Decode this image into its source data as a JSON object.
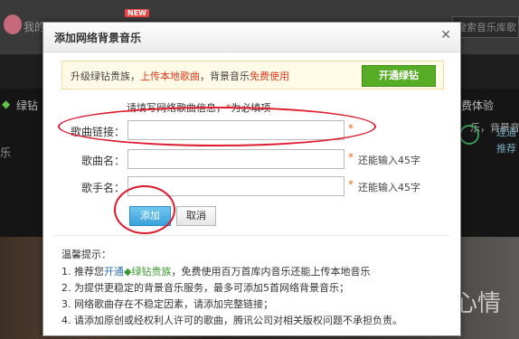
{
  "background": {
    "me_label": "我的",
    "new_badge": "NEW",
    "search_placeholder": "搜索音乐库歌",
    "right_text": "乐，背景音乐",
    "left_text": "绿钻",
    "left_text2": "乐",
    "right_text2": "费体验",
    "right_text3a": "连通",
    "right_text3b": "推荐",
    "photo_text": "心情"
  },
  "dialog": {
    "title": "添加网络背景音乐",
    "close_icon": "close-icon",
    "promo": {
      "part1": "升级绿钻贵族，",
      "part2": "上传本地歌曲",
      "part3": "，背景音乐",
      "part4": "免费使用",
      "button": "开通绿钻"
    },
    "hint": {
      "text": "请填写网络歌曲信息，",
      "star": "*",
      "suffix": "为必填项"
    },
    "fields": [
      {
        "label": "歌曲链接：",
        "value": "",
        "placeholder": "",
        "required": "*",
        "remain": ""
      },
      {
        "label": "歌曲名：",
        "value": "",
        "placeholder": "",
        "required": "*",
        "remain": "还能输入45字"
      },
      {
        "label": "歌手名：",
        "value": "",
        "placeholder": "",
        "required": "*",
        "remain": "还能输入45字"
      }
    ],
    "buttons": {
      "add": "添加",
      "cancel": "取消"
    },
    "tips": {
      "title": "温馨提示：",
      "line1_a": "1. 推荐您",
      "line1_link": "开通",
      "line1_gem": "◆绿钻贵族",
      "line1_b": "，免费使用百万首库内音乐还能上传本地音乐",
      "line2": "2. 为提供更稳定的背景音乐服务，最多可添加5首网络背景音乐；",
      "line3": "3. 网络歌曲存在不稳定因素，请添加完整链接；",
      "line4": "4. 请添加原创或经权利人许可的歌曲，腾讯公司对相关版权问题不承担负责。"
    }
  },
  "colors": {
    "accent_red": "#e03c1e",
    "promo_button": "#56ad25",
    "add_button": "#3aa1dc",
    "annotation": "#e0192c"
  }
}
